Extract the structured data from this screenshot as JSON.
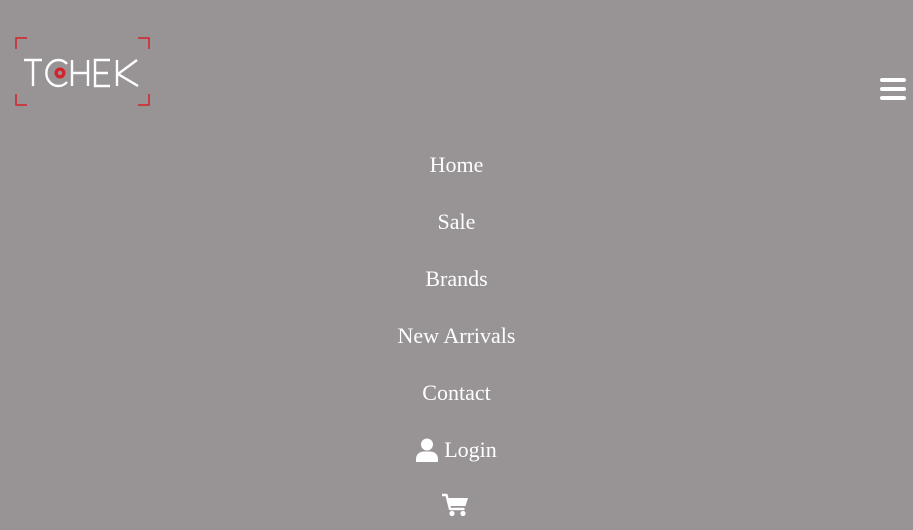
{
  "brand": {
    "logo_text": "TCHEK",
    "accent_color": "#d2232a",
    "text_color": "#ffffff"
  },
  "header": {
    "menu_icon": "hamburger-icon"
  },
  "nav": {
    "items": [
      {
        "label": "Home"
      },
      {
        "label": "Sale"
      },
      {
        "label": "Brands"
      },
      {
        "label": "New Arrivals"
      },
      {
        "label": "Contact"
      }
    ],
    "login": {
      "label": "Login",
      "icon": "user-icon"
    },
    "cart": {
      "icon": "shopping-cart-icon"
    }
  },
  "colors": {
    "background": "#989395",
    "text": "#ffffff"
  }
}
